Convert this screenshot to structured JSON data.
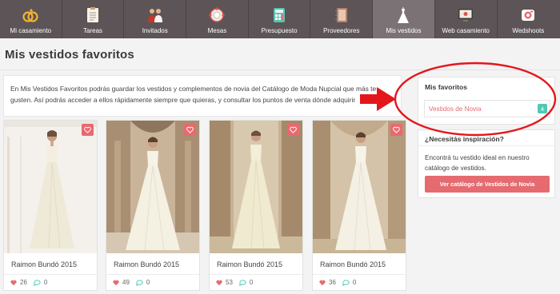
{
  "nav": {
    "items": [
      {
        "label": "Mi casamiento",
        "icon": "rings-icon"
      },
      {
        "label": "Tareas",
        "icon": "checklist-icon"
      },
      {
        "label": "Invitados",
        "icon": "guests-icon"
      },
      {
        "label": "Mesas",
        "icon": "table-icon"
      },
      {
        "label": "Presupuesto",
        "icon": "calculator-icon"
      },
      {
        "label": "Proveedores",
        "icon": "notebook-icon"
      },
      {
        "label": "Mis vestidos",
        "icon": "dress-icon",
        "active": true
      },
      {
        "label": "Web casamiento",
        "icon": "web-icon"
      },
      {
        "label": "Wedshoots",
        "icon": "camera-icon"
      }
    ]
  },
  "page": {
    "title": "Mis vestidos favoritos",
    "intro_lines": [
      "En Mis Vestidos Favoritos podrás guardar los vestidos y complementos de novia del Catálogo de Moda Nupcial que más te",
      "gusten. Así podrás acceder a ellos rápidamente siempre que quieras, y consultar los puntos de venta dónde adquirir"
    ]
  },
  "cards": [
    {
      "name": "Raimon Bundó 2015",
      "likes": "26",
      "comments": "0"
    },
    {
      "name": "Raimon Bundó 2015",
      "likes": "49",
      "comments": "0"
    },
    {
      "name": "Raimon Bundó 2015",
      "likes": "53",
      "comments": "0"
    },
    {
      "name": "Raimon Bundó 2015",
      "likes": "36",
      "comments": "0"
    }
  ],
  "sidebar": {
    "favorites": {
      "heading": "Mis favoritos",
      "link_label": "Vestidos de Novia",
      "count": "4"
    },
    "inspiration": {
      "heading": "¿Necesitás inspiración?",
      "text_lines": [
        "Encontrá tu vestido ideal en nuestro",
        "catálogo de vestidos."
      ],
      "button_label": "Ver catálogo de Vestidos de Novia"
    }
  },
  "colors": {
    "nav_bg": "#5c5457",
    "accent": "#e56b70",
    "count_badge": "#4fc9b5",
    "annotation": "#e3161b"
  }
}
